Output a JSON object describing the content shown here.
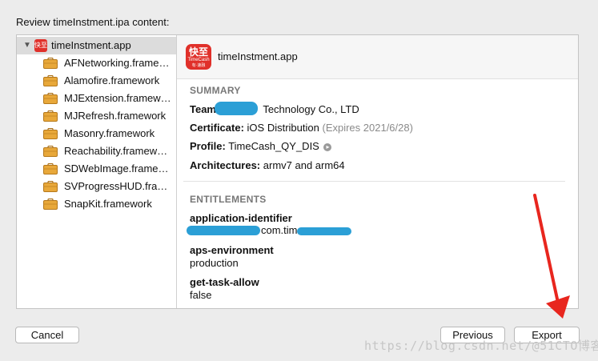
{
  "dialog_title": "Review timeInstment.ipa content:",
  "tree": {
    "root": {
      "label": "timeInstment.app",
      "icon": "app-icon",
      "icon_text": "快至"
    },
    "items": [
      {
        "label": "AFNetworking.frame…",
        "icon": "briefcase-icon"
      },
      {
        "label": "Alamofire.framework",
        "icon": "briefcase-icon"
      },
      {
        "label": "MJExtension.framew…",
        "icon": "briefcase-icon"
      },
      {
        "label": "MJRefresh.framework",
        "icon": "briefcase-icon"
      },
      {
        "label": "Masonry.framework",
        "icon": "briefcase-icon"
      },
      {
        "label": "Reachability.framew…",
        "icon": "briefcase-icon"
      },
      {
        "label": "SDWebImage.frame…",
        "icon": "briefcase-icon"
      },
      {
        "label": "SVProgressHUD.fra…",
        "icon": "briefcase-icon"
      },
      {
        "label": "SnapKit.framework",
        "icon": "briefcase-icon"
      }
    ]
  },
  "detail": {
    "app_name": "timeInstment.app",
    "icon_cn": "快至",
    "icon_en": "TimeCash",
    "icon_sub": "有·速融",
    "summary": {
      "heading": "SUMMARY",
      "team_label": "Team:",
      "team_value": "Technology Co., LTD",
      "certificate_label": "Certificate:",
      "certificate_value": "iOS Distribution",
      "certificate_expiry": "(Expires 2021/6/28)",
      "profile_label": "Profile:",
      "profile_value": "TimeCash_QY_DIS",
      "architectures_label": "Architectures:",
      "architectures_value": "armv7 and arm64"
    },
    "entitlements": {
      "heading": "ENTITLEMENTS",
      "items": [
        {
          "key": "application-identifier",
          "value": "com.time"
        },
        {
          "key": "aps-environment",
          "value": "production"
        },
        {
          "key": "get-task-allow",
          "value": "false"
        }
      ]
    }
  },
  "buttons": {
    "cancel": "Cancel",
    "previous": "Previous",
    "export": "Export"
  },
  "watermark": "https://blog.csdn.net/@51CTO博客",
  "colors": {
    "redaction": "#2b9fd6",
    "annotation_arrow": "#e8261e",
    "app_icon": "#e0302a",
    "framework_icon": "#e8a83a"
  }
}
